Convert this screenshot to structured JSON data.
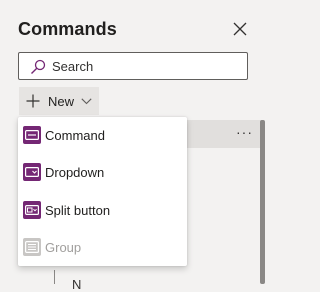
{
  "panel": {
    "title": "Commands"
  },
  "search": {
    "placeholder": "Search",
    "value": ""
  },
  "toolbar": {
    "new_label": "New"
  },
  "menu": {
    "items": [
      {
        "label": "Command",
        "icon": "command-icon",
        "disabled": false
      },
      {
        "label": "Dropdown",
        "icon": "dropdown-icon",
        "disabled": false
      },
      {
        "label": "Split button",
        "icon": "split-button-icon",
        "disabled": false
      },
      {
        "label": "Group",
        "icon": "group-icon",
        "disabled": true
      }
    ]
  },
  "tree": {
    "more_label": "···",
    "partial_item_label": "N"
  },
  "colors": {
    "accent_purple": "#742774",
    "disabled_icon": "#c8c6c4",
    "panel_bg": "#f3f2f1"
  }
}
